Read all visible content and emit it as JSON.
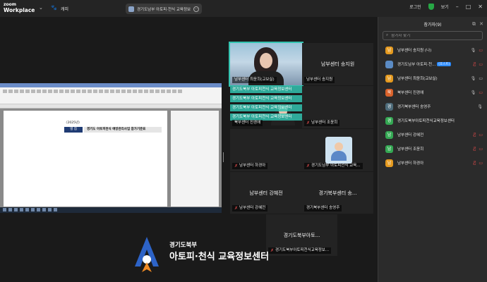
{
  "topbar": {
    "logo_line1": "zoom",
    "logo_line2": "Workplace",
    "app_label": "캐피",
    "meeting_title": "경기도남부 아토피·천식 교육정보",
    "login": "로그인",
    "view_label": "보기"
  },
  "shared_screen": {
    "doc_year": "〈2025년〉",
    "doc_tag": "별 첨",
    "doc_title": "경기도 아토피천식 예방관리사업 참가기준표"
  },
  "tiles": {
    "t1_label": "남부센터 최윤희(교보실)",
    "t2_center": "남부센터 송지원",
    "t2_label": "남부센터 송지원",
    "captions": [
      "경기도북부 아토피천식 교육정보센터",
      "경기도북부 아토피천식 교육정보센터",
      "경기도북부 아토피천식 교육정보센터",
      "경기도북부 아토피천식 교육정보센터"
    ],
    "t3_label": "북부센터 진경애",
    "t4_label": "남부센터 조윤희",
    "t5_label": "남부센터 하경아",
    "t6_label": "경기도남부 아토피천식 교육...",
    "t7_center": "남부센터 강혜전",
    "t7_label": "남부센터 강혜전",
    "t8_center": "경기북부센터 송...",
    "t8_label": "경기북부센터 송영주",
    "t9_center": "경기도북부아토...",
    "t9_label": "경기도북부아토피천식교육정보..."
  },
  "brand": {
    "subtitle": "경기도북부",
    "title": "아토피·천식 교육정보센터"
  },
  "participants_panel": {
    "title": "참가자(9)",
    "search_placeholder": "참가자 찾기",
    "items": [
      {
        "name": "남부센터 송지원 (나)",
        "initial": "남",
        "color": "#e59a1f",
        "tag": "",
        "mic": "on",
        "cam": "off"
      },
      {
        "name": "경기도남부 아토피·천...",
        "initial": "",
        "color": "#5b8bc4",
        "tag": "(호스트)",
        "mic": "off",
        "cam": "off"
      },
      {
        "name": "남부센터 최윤희(교보실)",
        "initial": "남",
        "color": "#e59a1f",
        "tag": "",
        "mic": "on",
        "cam": "on"
      },
      {
        "name": "북부센터 진경애",
        "initial": "북",
        "color": "#d9622b",
        "tag": "",
        "mic": "on",
        "cam": "off"
      },
      {
        "name": "경기북부센터 송영주",
        "initial": "경",
        "color": "#4d6b7a",
        "tag": "",
        "mic": "on",
        "cam": "none"
      },
      {
        "name": "경기도북부아토피천식교육정보센터",
        "initial": "경",
        "color": "#34a853",
        "tag": "",
        "mic": "none",
        "cam": "none"
      },
      {
        "name": "남부센터 강혜전",
        "initial": "남",
        "color": "#34a853",
        "tag": "",
        "mic": "off",
        "cam": "off"
      },
      {
        "name": "남부센터 조윤희",
        "initial": "남",
        "color": "#34a853",
        "tag": "",
        "mic": "off",
        "cam": "off"
      },
      {
        "name": "남부센터 하경아",
        "initial": "남",
        "color": "#e59a1f",
        "tag": "",
        "mic": "off",
        "cam": "off"
      }
    ]
  }
}
